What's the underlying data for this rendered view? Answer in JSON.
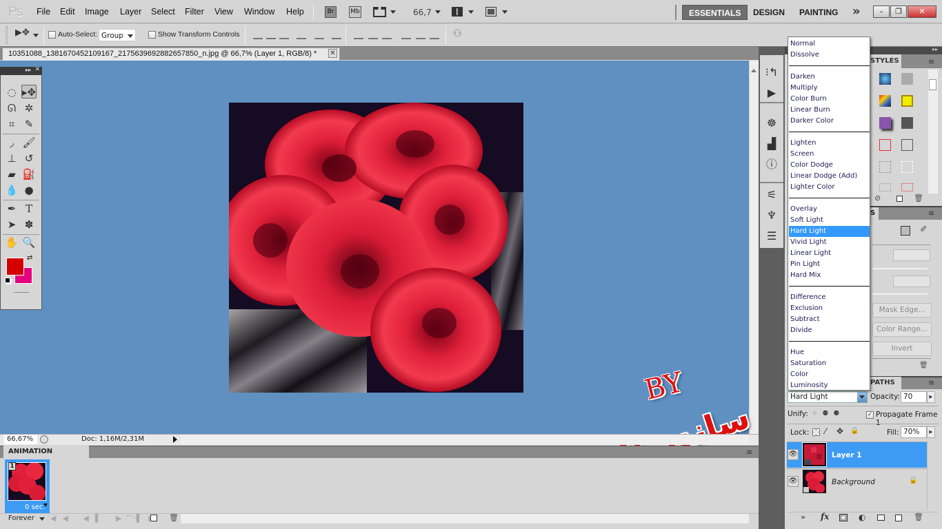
{
  "app": {
    "logo": "Ps"
  },
  "menu": [
    "File",
    "Edit",
    "Image",
    "Layer",
    "Select",
    "Filter",
    "View",
    "Window",
    "Help"
  ],
  "appbar": {
    "bridge": "Br",
    "minibridge": "Mb",
    "zoom_value": "66,7"
  },
  "workspaces": [
    "ESSENTIALS",
    "DESIGN",
    "PAINTING"
  ],
  "workspace_more": "»",
  "window_controls": {
    "minimize": "–",
    "restore": "❐",
    "close": "✕"
  },
  "options": {
    "auto_select_label": "Auto-Select:",
    "auto_select_checked": false,
    "auto_select_value": "Group",
    "show_transform_label": "Show Transform Controls",
    "show_transform_checked": false
  },
  "document": {
    "tab_title": "10351088_1381670452109167_2175639692882657850_n.jpg @ 66,7% (Layer 1, RGB/8) *",
    "close": "✕",
    "zoom_percent": "66,67%",
    "doc_info": "Doc: 1,16M/2,31M"
  },
  "colors": {
    "foreground": "#d40000",
    "background": "#e6007e",
    "canvas_bg": "#5f90c1",
    "selection": "#3d9bf3"
  },
  "animation": {
    "tab": "ANIMATION (FRAMES)",
    "frame_number": "1",
    "frame_delay": "0 sec.",
    "loop": "Forever"
  },
  "styles_panel": {
    "tab": "STYLES"
  },
  "masks_panel": {
    "tab": "S",
    "buttons": [
      "Mask Edge...",
      "Color Range...",
      "Invert"
    ]
  },
  "layers_panel": {
    "tab": "PATHS",
    "blend_mode": "Hard Light",
    "opacity_label": "Opacity:",
    "opacity": "70",
    "unify_label": "Unify:",
    "propagate_label": "Propagate Frame 1",
    "propagate_checked": true,
    "lock_label": "Lock:",
    "fill_label": "Fill:",
    "fill": "70%",
    "layers": [
      {
        "name": "Layer 1",
        "selected": true,
        "visible": true
      },
      {
        "name": "Background",
        "selected": false,
        "visible": true,
        "locked": true
      }
    ]
  },
  "blend_dropdown": {
    "groups": [
      [
        "Normal",
        "Dissolve"
      ],
      [
        "Darken",
        "Multiply",
        "Color Burn",
        "Linear Burn",
        "Darker Color"
      ],
      [
        "Lighten",
        "Screen",
        "Color Dodge",
        "Linear Dodge (Add)",
        "Lighter Color"
      ],
      [
        "Overlay",
        "Soft Light",
        "Hard Light",
        "Vivid Light",
        "Linear Light",
        "Pin Light",
        "Hard Mix"
      ],
      [
        "Difference",
        "Exclusion",
        "Subtract",
        "Divide"
      ],
      [
        "Hue",
        "Saturation",
        "Color",
        "Luminosity"
      ]
    ],
    "selected": "Hard Light"
  },
  "watermark": {
    "by": "BY",
    "name": "ساندريلا زماني"
  }
}
